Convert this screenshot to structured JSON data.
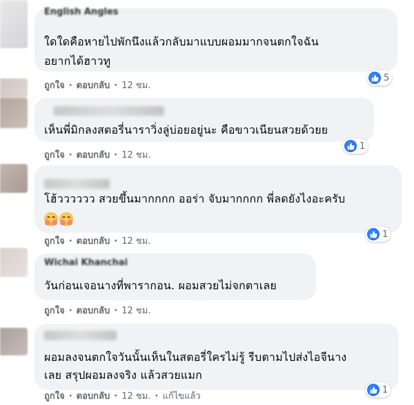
{
  "comments": [
    {
      "author": "English Angles",
      "lines": [
        "ใดใดคือหายไปพักนึงแล้วกลับมาแบบผอมมากจนตกใจฉัน",
        "อยากได้ฮาวทู"
      ],
      "actions": {
        "like": "ถูกใจ",
        "reply": "ตอบกลับ",
        "time": "12 ชม."
      },
      "reaction_count": "5"
    },
    {
      "author": "",
      "lines": [
        "เห็นพี่มิกลงสตอรี่นาราวิ่งลู่บ่อยอยู่นะ คือขาวเนียนสวยด้วยย"
      ],
      "actions": {
        "like": "ถูกใจ",
        "reply": "ตอบกลับ",
        "time": "12 ชม."
      },
      "reaction_count": "1"
    },
    {
      "author": "",
      "lines": [
        "โฮ้วววววว สวยขึ้นมากกกก ออร่า จับมากกกก พี่ลดยังไงอะครับ"
      ],
      "emojis": [
        "hugging-face",
        "hugging-face"
      ],
      "actions": {
        "like": "ถูกใจ",
        "reply": "ตอบกลับ",
        "time": "12 ชม."
      },
      "reaction_count": "1"
    },
    {
      "author": "Wichai Khanchai",
      "lines": [
        "วันก่อนเจอนางที่พารากอน. ผอมสวยไม่จกตาเลย"
      ],
      "actions": {
        "like": "ถูกใจ",
        "reply": "ตอบกลับ",
        "time": "12 ชม."
      }
    },
    {
      "author": "",
      "lines": [
        "ผอมลงจนตกใจวันนั้นเห็นในสตอรี่ใครไม่รู้ รีบตามไปส่งไอจีนาง",
        "เลย สรุปผอมลงจริง แล้วสวยแมก"
      ],
      "actions": {
        "like": "ถูกใจ",
        "reply": "ตอบกลับ",
        "time": "12 ชม.",
        "edited": "แก้ไขแล้ว"
      },
      "reaction_count": "1"
    }
  ],
  "icons": {
    "like": "like-thumb-icon"
  },
  "colors": {
    "bubble": "#f0f2f5",
    "meta": "#65676b",
    "like_blue": "#1877f2"
  }
}
